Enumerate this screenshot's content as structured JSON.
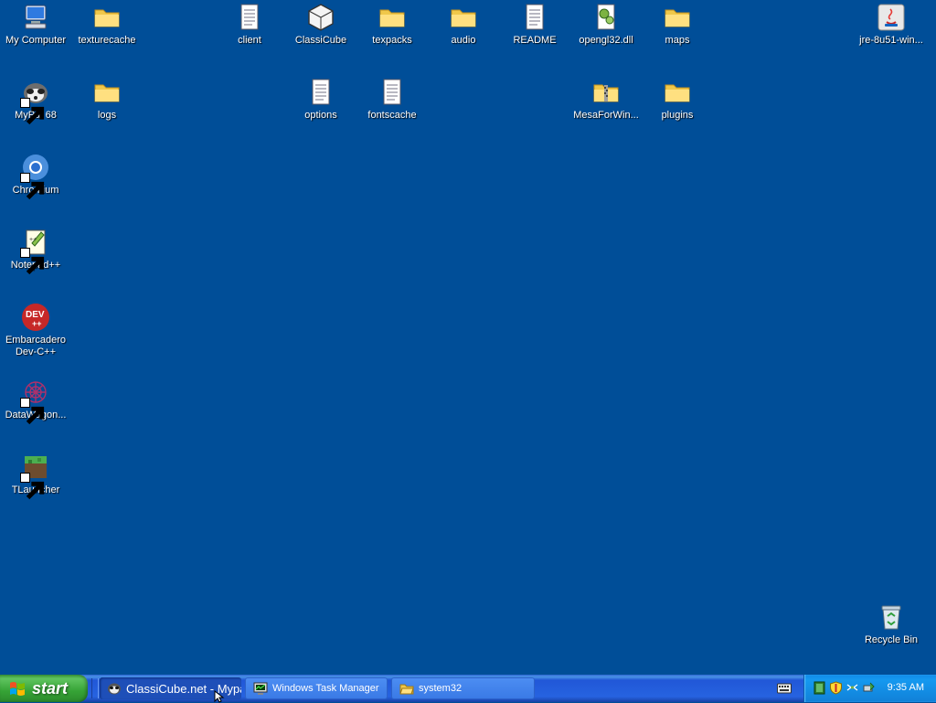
{
  "desktop": {
    "icons": [
      {
        "label": "My Computer"
      },
      {
        "label": "texturecache"
      },
      {
        "label": "client"
      },
      {
        "label": "ClassiCube"
      },
      {
        "label": "texpacks"
      },
      {
        "label": "audio"
      },
      {
        "label": "README"
      },
      {
        "label": "opengl32.dll"
      },
      {
        "label": "maps"
      },
      {
        "label": "jre-8u51-win..."
      },
      {
        "label": "MyPal 68"
      },
      {
        "label": "logs"
      },
      {
        "label": "options"
      },
      {
        "label": "fontscache"
      },
      {
        "label": "MesaForWin..."
      },
      {
        "label": "plugins"
      },
      {
        "label": "Chromium"
      },
      {
        "label": "Notepad++"
      },
      {
        "label": "Embarcadero Dev-C++"
      },
      {
        "label": "DataWagon..."
      },
      {
        "label": "TLauncher"
      },
      {
        "label": "Recycle Bin"
      }
    ]
  },
  "taskbar": {
    "start_label": "start",
    "buttons": [
      {
        "label": "ClassiCube.net - Mypal"
      },
      {
        "label": "Windows Task Manager"
      },
      {
        "label": "system32"
      }
    ],
    "clock": "9:35 AM"
  },
  "colors": {
    "desktop_bg": "#004e98",
    "taskbar_blue": "#2663e0",
    "start_green": "#36a336",
    "tray_blue": "#1599f0"
  }
}
